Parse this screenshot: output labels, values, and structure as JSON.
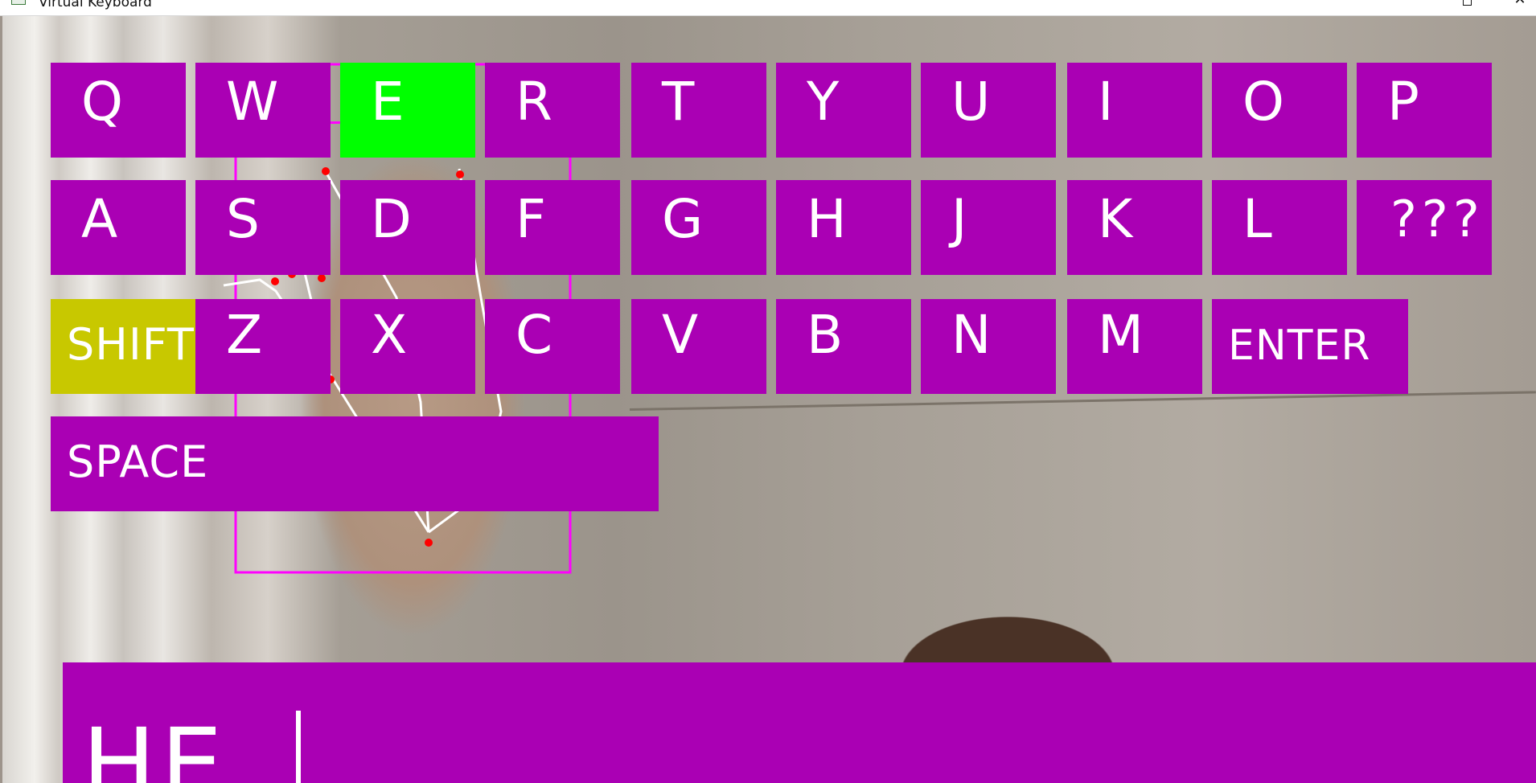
{
  "window": {
    "title": "Virtual Keyboard",
    "maximize_icon": "maximize-icon",
    "close_icon": "close-icon",
    "close_glyph": "✕"
  },
  "colors": {
    "key": "#aa00b4",
    "pressed": "#00ff00",
    "shift": "#c8c800",
    "text": "#ffffff",
    "tracking_outline": "#ff00ff",
    "landmark": "#ff0000"
  },
  "keyboard": {
    "row1": [
      "Q",
      "W",
      "E",
      "R",
      "T",
      "Y",
      "U",
      "I",
      "O",
      "P"
    ],
    "row2": [
      "A",
      "S",
      "D",
      "F",
      "G",
      "H",
      "J",
      "K",
      "L",
      "???"
    ],
    "row3": [
      "SHIFT",
      "Z",
      "X",
      "C",
      "V",
      "B",
      "N",
      "M",
      "ENTER"
    ],
    "row4": [
      "SPACE"
    ],
    "pressed_key": "E",
    "shift_active": true
  },
  "output": {
    "typed_text": "HE"
  }
}
